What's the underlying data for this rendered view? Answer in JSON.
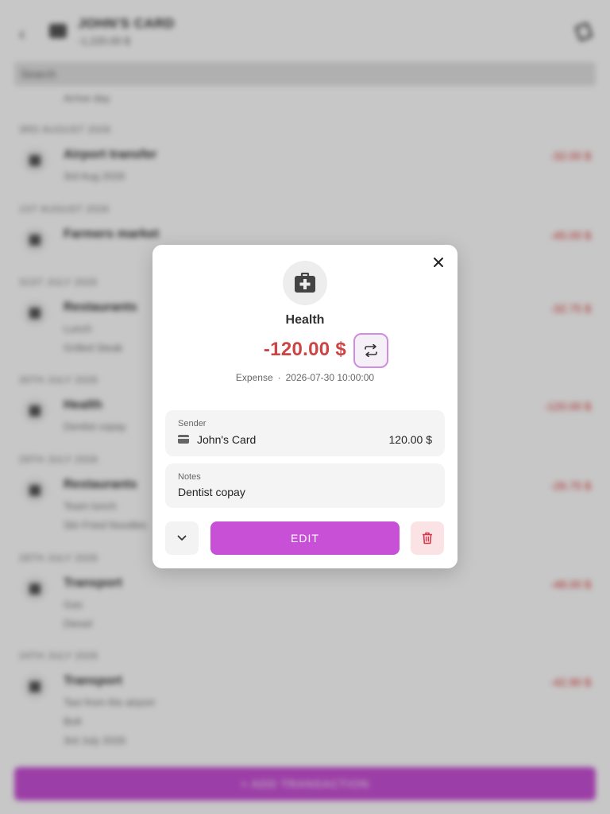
{
  "background": {
    "header": {
      "title": "JOHN'S CARD",
      "subtitle": "-1,220.00 $"
    },
    "search": {
      "placeholder": "Search"
    },
    "partial_row": {
      "subtitle": "Arrive day"
    },
    "groups": [
      {
        "date": "3RD AUGUST 2026",
        "items": [
          {
            "title": "Airport transfer",
            "lines": [
              "3rd Aug 2026"
            ],
            "amount": "-32.00 $"
          }
        ]
      },
      {
        "date": "1ST AUGUST 2026",
        "items": [
          {
            "title": "Farmers market",
            "lines": [],
            "amount": "-45.00 $"
          }
        ]
      },
      {
        "date": "31ST JULY 2026",
        "items": [
          {
            "title": "Restaurants",
            "lines": [
              "Lunch",
              "Grilled Steak"
            ],
            "amount": "-32.75 $"
          }
        ]
      },
      {
        "date": "30TH JULY 2026",
        "items": [
          {
            "title": "Health",
            "lines": [
              "Dentist copay"
            ],
            "amount": "-120.00 $"
          }
        ]
      },
      {
        "date": "29TH JULY 2026",
        "items": [
          {
            "title": "Restaurants",
            "lines": [
              "Team lunch",
              "Stir-Fried Noodles"
            ],
            "amount": "-26.75 $"
          }
        ]
      },
      {
        "date": "28TH JULY 2026",
        "items": [
          {
            "title": "Transport",
            "lines": [
              "Gas",
              "Diesel"
            ],
            "amount": "-48.00 $"
          }
        ]
      },
      {
        "date": "24TH JULY 2026",
        "items": [
          {
            "title": "Transport",
            "lines": [
              "Taxi from the airport",
              "Bolt",
              "3rd July 2026"
            ],
            "amount": "-42.90 $"
          }
        ]
      }
    ],
    "add_button": {
      "label": "ADD TRANSACTION"
    }
  },
  "dialog": {
    "category": {
      "name": "Health",
      "icon": "medical-bag-icon"
    },
    "amount": "-120.00 $",
    "amount_color": "#cc4444",
    "type": "Expense",
    "separator": "·",
    "datetime": "2026-07-30 10:00:00",
    "sender": {
      "label": "Sender",
      "account": "John's Card",
      "amount": "120.00 $"
    },
    "notes": {
      "label": "Notes",
      "value": "Dentist copay"
    },
    "actions": {
      "edit_label": "EDIT"
    },
    "accent_color": "#c850d6"
  }
}
